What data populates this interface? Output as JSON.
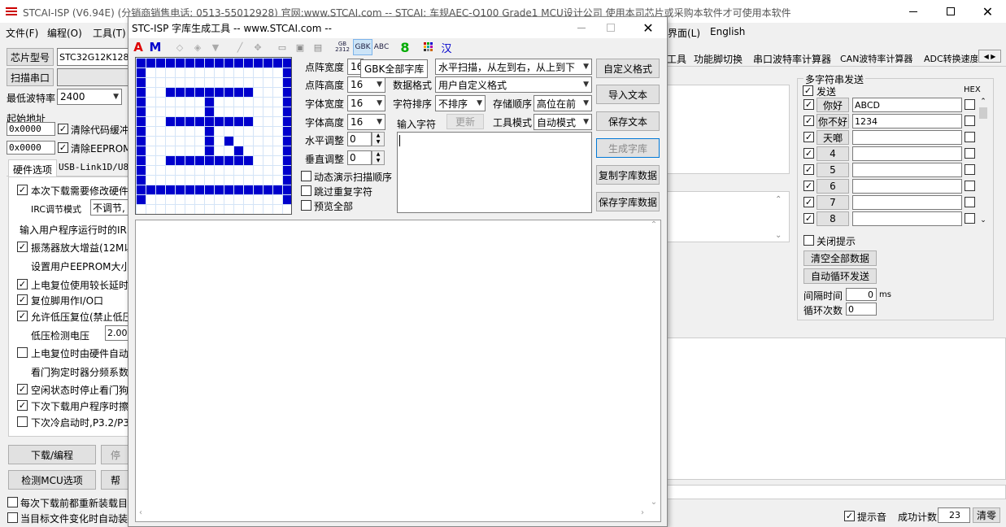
{
  "window": {
    "title": "STCAI-ISP (V6.94E) (分销商销售电话: 0513-55012928) 官网:www.STCAI.com  -- STCAI: 车规AEC-Q100 Grade1 MCU设计公司 使用本司芯片或采购本软件才可使用本软件"
  },
  "menu": {
    "file": "文件(F)",
    "program": "编程(O)",
    "tools": "工具(T)",
    "interface": "界面(L)",
    "english": "English"
  },
  "left": {
    "chip_model_label": "芯片型号",
    "chip_model_value": "STC32G12K128",
    "scan_port_button": "扫描串口",
    "baud_label": "最低波特率",
    "baud_value": "2400",
    "start_addr_label": "起始地址",
    "addr1": "0x0000",
    "clear_code_buffer": "清除代码缓冲",
    "addr2": "0x0000",
    "clear_eeprom_buffer": "清除EEPROM缓",
    "tab_hardware": "硬件选项",
    "tab_usblink": "USB-Link1D/U8W",
    "opt1": "本次下载需要修改硬件",
    "irc_mode_label": "IRC调节模式",
    "irc_mode_value": "不调节,",
    "irc_freq_label": "输入用户程序运行时的IR",
    "opt2": "振荡器放大增益(12M以",
    "eeprom_size_label": "设置用户EEPROM大小",
    "opt3": "上电复位使用较长延时",
    "opt4": "复位脚用作I/O口",
    "opt5": "允许低压复位(禁止低压",
    "lvd_label": "低压检测电压",
    "lvd_value": "2.00",
    "opt6": "上电复位时由硬件自动",
    "wdt_label": "看门狗定时器分频系数",
    "opt7": "空闲状态时停止看门狗",
    "opt8": "下次下载用户程序时擦",
    "opt9": "下次冷启动时,P3.2/P3",
    "download_button": "下载/编程",
    "stop_button": "停",
    "check_mcu_button": "检测MCU选项",
    "help_button": "帮",
    "reload_each": "每次下载前都重新装载目",
    "auto_reload": "当目标文件变化时自动装"
  },
  "right_tabs": [
    "工具",
    "功能脚切换",
    "串口波特率计算器",
    "CAN波特率计算器",
    "ADC转换速度"
  ],
  "multi_send": {
    "title": "多字符串发送",
    "send_header": "发送",
    "hex_header": "HEX",
    "rows": [
      {
        "checked": true,
        "label": "你好",
        "value": "ABCD"
      },
      {
        "checked": true,
        "label": "你不好",
        "value": "1234"
      },
      {
        "checked": true,
        "label": "天啷",
        "value": ""
      },
      {
        "checked": true,
        "label": "4",
        "value": ""
      },
      {
        "checked": true,
        "label": "5",
        "value": ""
      },
      {
        "checked": true,
        "label": "6",
        "value": ""
      },
      {
        "checked": true,
        "label": "7",
        "value": ""
      },
      {
        "checked": true,
        "label": "8",
        "value": ""
      }
    ],
    "close_prompt": "关闭提示",
    "clear_all_button": "清空全部数据",
    "auto_loop_button": "自动循环发送",
    "interval_label": "间隔时间",
    "interval_value": "0",
    "interval_unit": "ms",
    "loop_label": "循环次数",
    "loop_value": "0"
  },
  "status": {
    "beep": "提示音",
    "success_count_label": "成功计数",
    "success_count_value": "23",
    "clear_button": "清零"
  },
  "dialog": {
    "title": "STC-ISP 字库生成工具 -- www.STCAI.com --",
    "tooltip": "GBK全部字库",
    "toolbar": {
      "gb2312": "GB\n2312",
      "gbk": "GBK",
      "abc": "ABC",
      "han": "汉"
    },
    "dot_width_label": "点阵宽度",
    "dot_width_value": "16",
    "dot_height_label": "点阵高度",
    "dot_height_value": "16",
    "font_width_label": "字体宽度",
    "font_width_value": "16",
    "font_height_label": "字体高度",
    "font_height_value": "16",
    "h_adjust_label": "水平调整",
    "h_adjust_value": "0",
    "v_adjust_label": "垂直调整",
    "v_adjust_value": "0",
    "scan_mode_value": "水平扫描，从左到右，从上到下",
    "data_format_label": "数据格式",
    "data_format_value": "用户自定义格式",
    "char_sort_label": "字符排序",
    "char_sort_value": "不排序",
    "store_order_label": "存储顺序",
    "store_order_value": "高位在前",
    "input_char_label": "输入字符",
    "update_button": "更新",
    "tool_mode_label": "工具模式",
    "tool_mode_value": "自动模式",
    "dynamic_scan": "动态演示扫描顺序",
    "skip_dup": "跳过重复字符",
    "preview_all": "预览全部",
    "custom_format_button": "自定义格式",
    "import_text_button": "导入文本",
    "save_text_button": "保存文本",
    "generate_button": "生成字库",
    "copy_data_button": "复制字库数据",
    "save_data_button": "保存字库数据"
  },
  "bitmap_rows": [
    "1111111111111111",
    "1000000000000001",
    "1000000000000001",
    "1001111111110001",
    "1000000100000001",
    "1000000100000001",
    "1001111111110001",
    "1000000100000001",
    "1000000101000001",
    "1000000100100001",
    "1001111111110001",
    "1000000000000001",
    "1000000000000001",
    "1111111111111111",
    "1000000000000001",
    "0000000000000000"
  ]
}
